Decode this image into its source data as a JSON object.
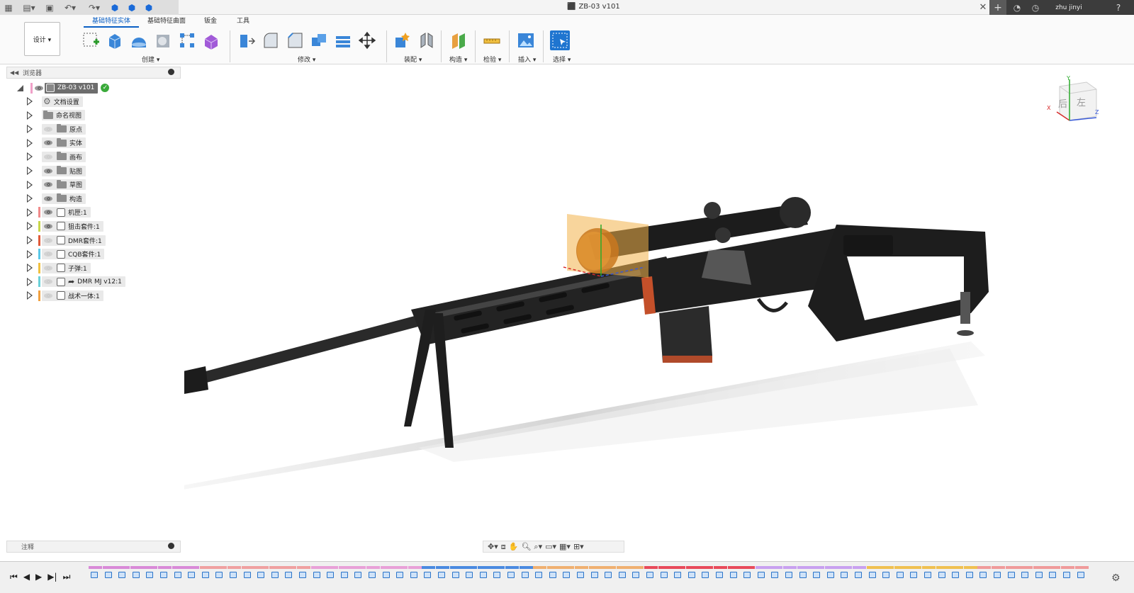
{
  "window": {
    "title": "ZB-03 v101",
    "user": "zhu jinyi"
  },
  "ribbon": {
    "tabs": [
      "基础特征实体",
      "基础特征曲面",
      "钣金",
      "工具"
    ],
    "active_tab": 0,
    "workspace_button": "设计 ▾",
    "groups": [
      "创建 ▾",
      "修改 ▾",
      "装配 ▾",
      "构造 ▾",
      "检验 ▾",
      "插入 ▾",
      "选择 ▾"
    ]
  },
  "browser": {
    "title": "浏览器",
    "root": "ZB-03 v101",
    "items": [
      {
        "label": "文档设置",
        "type": "settings",
        "visible": null,
        "color": ""
      },
      {
        "label": "命名视图",
        "type": "folder",
        "visible": null,
        "color": ""
      },
      {
        "label": "原点",
        "type": "folder",
        "visible": false,
        "color": ""
      },
      {
        "label": "实体",
        "type": "folder",
        "visible": true,
        "color": ""
      },
      {
        "label": "画布",
        "type": "folder",
        "visible": false,
        "color": ""
      },
      {
        "label": "贴图",
        "type": "folder",
        "visible": true,
        "color": ""
      },
      {
        "label": "草图",
        "type": "folder",
        "visible": true,
        "color": ""
      },
      {
        "label": "构造",
        "type": "folder",
        "visible": true,
        "color": ""
      },
      {
        "label": "机匣:1",
        "type": "component",
        "visible": true,
        "color": "#f08a8a"
      },
      {
        "label": "狙击套件:1",
        "type": "component",
        "visible": true,
        "color": "#c8d64a"
      },
      {
        "label": "DMR套件:1",
        "type": "component",
        "visible": false,
        "color": "#e05a3a"
      },
      {
        "label": "CQB套件:1",
        "type": "component",
        "visible": false,
        "color": "#5ac8e8"
      },
      {
        "label": "子弹:1",
        "type": "component",
        "visible": false,
        "color": "#f0c040"
      },
      {
        "label": "DMR MJ v12:1",
        "type": "link",
        "visible": false,
        "color": "#6ad0d8"
      },
      {
        "label": "战术一体:1",
        "type": "component",
        "visible": false,
        "color": "#f0a040"
      }
    ]
  },
  "annotations": {
    "title": "注释"
  },
  "viewcube": {
    "faces": [
      "后",
      "左"
    ],
    "axes": [
      "Y",
      "X",
      "Z"
    ]
  },
  "colors": {
    "accent": "#0a5fc4",
    "tool_blue": "#2a74c9"
  }
}
